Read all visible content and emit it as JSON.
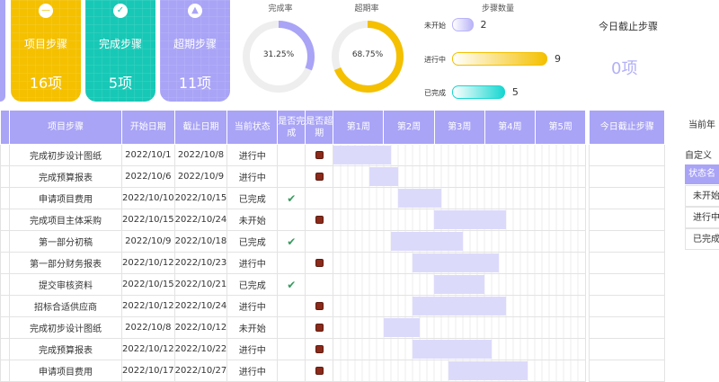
{
  "cards": [
    {
      "label": "项目步骤",
      "value": "16项",
      "icon": "minus-icon",
      "color": "#f4c000"
    },
    {
      "label": "完成步骤",
      "value": "5项",
      "icon": "check-icon",
      "color": "#17c8b6"
    },
    {
      "label": "超期步骤",
      "value": "11项",
      "icon": "warning-triangle-icon",
      "color": "#a9a4f6"
    }
  ],
  "completion": {
    "title": "完成率",
    "value": "31.25%",
    "fraction": 0.3125,
    "color": "#a9a4f6"
  },
  "overdue": {
    "title": "超期率",
    "value": "68.75%",
    "fraction": 0.6875,
    "color": "#f4c000"
  },
  "step_count": {
    "title": "步骤数量",
    "rows": [
      {
        "label": "未开始",
        "value": "2",
        "count": 2,
        "color": "#b9b4f8"
      },
      {
        "label": "进行中",
        "value": "9",
        "count": 9,
        "color": "#f4c000"
      },
      {
        "label": "已完成",
        "value": "5",
        "count": 5,
        "color": "#17d6d0"
      }
    ]
  },
  "today_stop": {
    "title": "今日截止步骤",
    "value": "0项"
  },
  "table": {
    "headers": {
      "step": "项目步骤",
      "start": "开始日期",
      "end": "截止日期",
      "status": "当前状态",
      "done": "是否完成",
      "overdue": "是否超期",
      "today": "今日截止步骤"
    },
    "weeks": [
      "第1周",
      "第2周",
      "第3周",
      "第4周",
      "第5周"
    ],
    "rows": [
      {
        "step": "完成初步设计图纸",
        "start": "2022/10/1",
        "end": "2022/10/8",
        "status": "进行中",
        "done": false,
        "overdue": true,
        "s": 0,
        "e": 7
      },
      {
        "step": "完成预算报表",
        "start": "2022/10/6",
        "end": "2022/10/9",
        "status": "进行中",
        "done": false,
        "overdue": true,
        "s": 5,
        "e": 8
      },
      {
        "step": "申请项目费用",
        "start": "2022/10/10",
        "end": "2022/10/15",
        "status": "已完成",
        "done": true,
        "overdue": false,
        "s": 9,
        "e": 14
      },
      {
        "step": "完成项目主体采购",
        "start": "2022/10/15",
        "end": "2022/10/24",
        "status": "未开始",
        "done": false,
        "overdue": true,
        "s": 14,
        "e": 23
      },
      {
        "step": "第一部分初稿",
        "start": "2022/10/9",
        "end": "2022/10/18",
        "status": "已完成",
        "done": true,
        "overdue": false,
        "s": 8,
        "e": 17
      },
      {
        "step": "第一部分财务报表",
        "start": "2022/10/12",
        "end": "2022/10/23",
        "status": "进行中",
        "done": false,
        "overdue": true,
        "s": 11,
        "e": 22
      },
      {
        "step": "提交审核资料",
        "start": "2022/10/15",
        "end": "2022/10/21",
        "status": "已完成",
        "done": true,
        "overdue": false,
        "s": 14,
        "e": 20
      },
      {
        "step": "招标合适供应商",
        "start": "2022/10/12",
        "end": "2022/10/24",
        "status": "进行中",
        "done": false,
        "overdue": true,
        "s": 11,
        "e": 23
      },
      {
        "step": "完成初步设计图纸",
        "start": "2022/10/8",
        "end": "2022/10/12",
        "status": "未开始",
        "done": false,
        "overdue": true,
        "s": 7,
        "e": 11
      },
      {
        "step": "完成预算报表",
        "start": "2022/10/12",
        "end": "2022/10/22",
        "status": "进行中",
        "done": false,
        "overdue": true,
        "s": 11,
        "e": 21
      },
      {
        "step": "申请项目费用",
        "start": "2022/10/17",
        "end": "2022/10/27",
        "status": "进行中",
        "done": false,
        "overdue": true,
        "s": 16,
        "e": 26
      }
    ]
  },
  "sidebar": {
    "current_year": "当前年",
    "custom": "自定义",
    "status_name": "状态名",
    "status_items": [
      "未开始",
      "进行中",
      "已完成"
    ]
  }
}
